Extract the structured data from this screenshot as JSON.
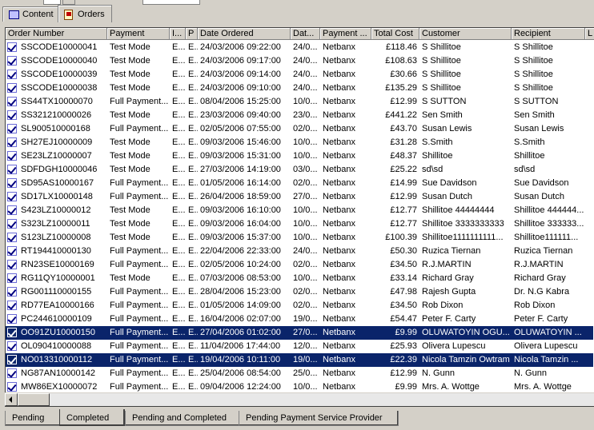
{
  "top_tabs": [
    {
      "label": "Content",
      "icon": "content-icon",
      "active": false
    },
    {
      "label": "Orders",
      "icon": "orders-icon",
      "active": true
    }
  ],
  "columns": [
    "Order Number",
    "Payment",
    "I...",
    "P",
    "Date Ordered",
    "Dat...",
    "Payment ...",
    "Total Cost",
    "Customer",
    "Recipient",
    "L"
  ],
  "rows": [
    {
      "order": "SSCODE10000041",
      "payment": "Test Mode",
      "i": "E...",
      "p": "E...",
      "date": "24/03/2006 09:22:00",
      "dat": "24/0...",
      "pay2": "Netbanx",
      "total": "£118.46",
      "customer": "S Shillitoe",
      "recipient": "S Shillitoe",
      "selected": false
    },
    {
      "order": "SSCODE10000040",
      "payment": "Test Mode",
      "i": "E...",
      "p": "E...",
      "date": "24/03/2006 09:17:00",
      "dat": "24/0...",
      "pay2": "Netbanx",
      "total": "£108.63",
      "customer": "S Shillitoe",
      "recipient": "S Shillitoe",
      "selected": false
    },
    {
      "order": "SSCODE10000039",
      "payment": "Test Mode",
      "i": "E...",
      "p": "E...",
      "date": "24/03/2006 09:14:00",
      "dat": "24/0...",
      "pay2": "Netbanx",
      "total": "£30.66",
      "customer": "S Shillitoe",
      "recipient": "S Shillitoe",
      "selected": false
    },
    {
      "order": "SSCODE10000038",
      "payment": "Test Mode",
      "i": "E...",
      "p": "E...",
      "date": "24/03/2006 09:10:00",
      "dat": "24/0...",
      "pay2": "Netbanx",
      "total": "£135.29",
      "customer": "S Shillitoe",
      "recipient": "S Shillitoe",
      "selected": false
    },
    {
      "order": "SS44TX10000070",
      "payment": "Full Payment...",
      "i": "E...",
      "p": "E...",
      "date": "08/04/2006 15:25:00",
      "dat": "10/0...",
      "pay2": "Netbanx",
      "total": "£12.99",
      "customer": "S SUTTON",
      "recipient": "S SUTTON",
      "selected": false
    },
    {
      "order": "SS321210000026",
      "payment": "Test Mode",
      "i": "E...",
      "p": "E...",
      "date": "23/03/2006 09:40:00",
      "dat": "23/0...",
      "pay2": "Netbanx",
      "total": "£441.22",
      "customer": "Sen Smith",
      "recipient": "Sen Smith",
      "selected": false
    },
    {
      "order": "SL900510000168",
      "payment": "Full Payment...",
      "i": "E...",
      "p": "E...",
      "date": "02/05/2006 07:55:00",
      "dat": "02/0...",
      "pay2": "Netbanx",
      "total": "£43.70",
      "customer": "Susan Lewis",
      "recipient": "Susan Lewis",
      "selected": false
    },
    {
      "order": "SH27EJ10000009",
      "payment": "Test Mode",
      "i": "E...",
      "p": "E...",
      "date": "09/03/2006 15:46:00",
      "dat": "10/0...",
      "pay2": "Netbanx",
      "total": "£31.28",
      "customer": "S.Smith",
      "recipient": "S.Smith",
      "selected": false
    },
    {
      "order": "SE23LZ10000007",
      "payment": "Test Mode",
      "i": "E...",
      "p": "E...",
      "date": "09/03/2006 15:31:00",
      "dat": "10/0...",
      "pay2": "Netbanx",
      "total": "£48.37",
      "customer": "Shillitoe",
      "recipient": "Shillitoe",
      "selected": false
    },
    {
      "order": "SDFDGH10000046",
      "payment": "Test Mode",
      "i": "E...",
      "p": "E...",
      "date": "27/03/2006 14:19:00",
      "dat": "03/0...",
      "pay2": "Netbanx",
      "total": "£25.22",
      "customer": "sd\\sd",
      "recipient": "sd\\sd",
      "selected": false
    },
    {
      "order": "SD95AS10000167",
      "payment": "Full Payment...",
      "i": "E...",
      "p": "E...",
      "date": "01/05/2006 16:14:00",
      "dat": "02/0...",
      "pay2": "Netbanx",
      "total": "£14.99",
      "customer": "Sue Davidson",
      "recipient": "Sue Davidson",
      "selected": false
    },
    {
      "order": "SD17LX10000148",
      "payment": "Full Payment...",
      "i": "E...",
      "p": "E...",
      "date": "26/04/2006 18:59:00",
      "dat": "27/0...",
      "pay2": "Netbanx",
      "total": "£12.99",
      "customer": "Susan Dutch",
      "recipient": "Susan Dutch",
      "selected": false
    },
    {
      "order": "S423LZ10000012",
      "payment": "Test Mode",
      "i": "E...",
      "p": "E...",
      "date": "09/03/2006 16:10:00",
      "dat": "10/0...",
      "pay2": "Netbanx",
      "total": "£12.77",
      "customer": "Shillitoe 44444444",
      "recipient": "Shillitoe 444444...",
      "selected": false
    },
    {
      "order": "S323LZ10000011",
      "payment": "Test Mode",
      "i": "E...",
      "p": "E...",
      "date": "09/03/2006 16:04:00",
      "dat": "10/0...",
      "pay2": "Netbanx",
      "total": "£12.77",
      "customer": "Shillitoe 3333333333",
      "recipient": "Shillitoe 333333...",
      "selected": false
    },
    {
      "order": "S123LZ10000008",
      "payment": "Test Mode",
      "i": "E...",
      "p": "E...",
      "date": "09/03/2006 15:37:00",
      "dat": "10/0...",
      "pay2": "Netbanx",
      "total": "£100.39",
      "customer": "Shillitoe1111111111...",
      "recipient": "Shillitoe111111...",
      "selected": false
    },
    {
      "order": "RT194410000130",
      "payment": "Full Payment...",
      "i": "E...",
      "p": "E...",
      "date": "22/04/2006 22:33:00",
      "dat": "24/0...",
      "pay2": "Netbanx",
      "total": "£50.30",
      "customer": "Ruzica Tiernan",
      "recipient": "Ruzica Tiernan",
      "selected": false
    },
    {
      "order": "RN23SE10000169",
      "payment": "Full Payment...",
      "i": "E...",
      "p": "E...",
      "date": "02/05/2006 10:24:00",
      "dat": "02/0...",
      "pay2": "Netbanx",
      "total": "£34.50",
      "customer": "R.J.MARTIN",
      "recipient": "R.J.MARTIN",
      "selected": false
    },
    {
      "order": "RG11QY10000001",
      "payment": "Test Mode",
      "i": "E...",
      "p": "E...",
      "date": "07/03/2006 08:53:00",
      "dat": "10/0...",
      "pay2": "Netbanx",
      "total": "£33.14",
      "customer": "Richard Gray",
      "recipient": "Richard Gray",
      "selected": false
    },
    {
      "order": "RG001110000155",
      "payment": "Full Payment...",
      "i": "E...",
      "p": "E...",
      "date": "28/04/2006 15:23:00",
      "dat": "02/0...",
      "pay2": "Netbanx",
      "total": "£47.98",
      "customer": "Rajesh Gupta",
      "recipient": "Dr. N.G Kabra",
      "selected": false
    },
    {
      "order": "RD77EA10000166",
      "payment": "Full Payment...",
      "i": "E...",
      "p": "E...",
      "date": "01/05/2006 14:09:00",
      "dat": "02/0...",
      "pay2": "Netbanx",
      "total": "£34.50",
      "customer": "Rob Dixon",
      "recipient": "Rob Dixon",
      "selected": false
    },
    {
      "order": "PC244610000109",
      "payment": "Full Payment...",
      "i": "E...",
      "p": "E...",
      "date": "16/04/2006 02:07:00",
      "dat": "19/0...",
      "pay2": "Netbanx",
      "total": "£54.47",
      "customer": "Peter F. Carty",
      "recipient": "Peter F. Carty",
      "selected": false
    },
    {
      "order": "OO91ZU10000150",
      "payment": "Full Payment...",
      "i": "E...",
      "p": "E...",
      "date": "27/04/2006 01:02:00",
      "dat": "27/0...",
      "pay2": "Netbanx",
      "total": "£9.99",
      "customer": "OLUWATOYIN OGU...",
      "recipient": "OLUWATOYIN ...",
      "selected": true
    },
    {
      "order": "OL090410000088",
      "payment": "Full Payment...",
      "i": "E...",
      "p": "E...",
      "date": "11/04/2006 17:44:00",
      "dat": "12/0...",
      "pay2": "Netbanx",
      "total": "£25.93",
      "customer": "Olivera Lupescu",
      "recipient": "Olivera Lupescu",
      "selected": false
    },
    {
      "order": "NO013310000112",
      "payment": "Full Payment...",
      "i": "E...",
      "p": "E...",
      "date": "19/04/2006 10:11:00",
      "dat": "19/0...",
      "pay2": "Netbanx",
      "total": "£22.39",
      "customer": "Nicola Tamzin Owtram",
      "recipient": "Nicola Tamzin ...",
      "selected": true
    },
    {
      "order": "NG87AN10000142",
      "payment": "Full Payment...",
      "i": "E...",
      "p": "E...",
      "date": "25/04/2006 08:54:00",
      "dat": "25/0...",
      "pay2": "Netbanx",
      "total": "£12.99",
      "customer": "N. Gunn",
      "recipient": "N. Gunn",
      "selected": false
    },
    {
      "order": "MW86EX10000072",
      "payment": "Full Payment...",
      "i": "E...",
      "p": "E...",
      "date": "09/04/2006 12:24:00",
      "dat": "10/0...",
      "pay2": "Netbanx",
      "total": "£9.99",
      "customer": "Mrs. A. Wottge",
      "recipient": "Mrs. A. Wottge",
      "selected": false
    }
  ],
  "bottom_tabs": [
    {
      "label": "Pending",
      "active": false
    },
    {
      "label": "Completed",
      "active": true
    },
    {
      "label": "Pending and Completed",
      "active": false
    },
    {
      "label": "Pending Payment Service Provider",
      "active": false
    }
  ]
}
